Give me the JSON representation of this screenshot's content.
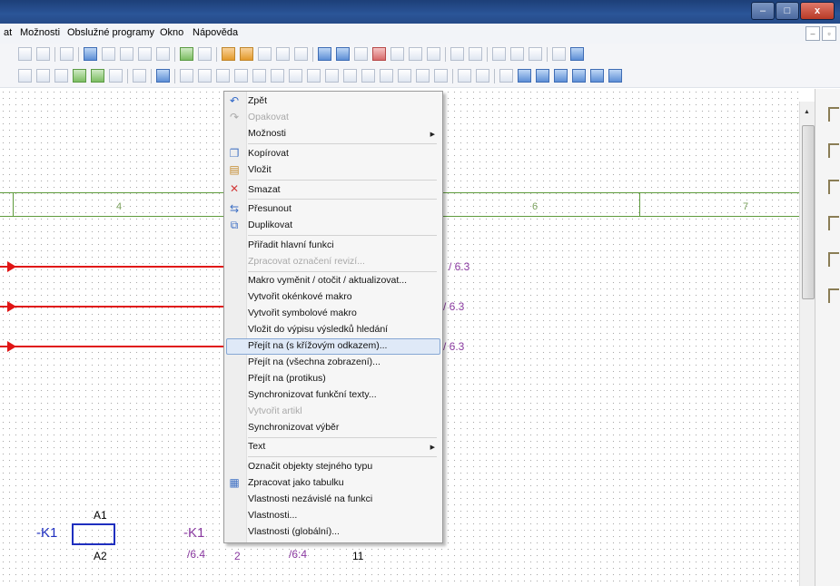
{
  "menubar": {
    "items": [
      "at",
      "Možnosti",
      "Obslužné programy",
      "Okno",
      "Nápověda"
    ]
  },
  "window_buttons": {
    "minimize": "–",
    "maximize": "□",
    "close": "x"
  },
  "canvas": {
    "zones": [
      "4",
      "6",
      "7"
    ],
    "xrefs": [
      "/ 6.3",
      "/ 6.3",
      "/ 6.3"
    ],
    "device": {
      "tag_left": "-K1",
      "coil_top": "A1",
      "coil_bottom": "A2",
      "tag_right": "-K1",
      "ref_right": "/6.4",
      "contact_a": "2",
      "contact_ref": "/6:4",
      "contact_b": "11"
    }
  },
  "context_menu": {
    "items": [
      {
        "label": "Zpět",
        "icon": "undo-icon",
        "enabled": true
      },
      {
        "label": "Opakovat",
        "icon": "redo-icon",
        "enabled": false
      },
      {
        "label": "Možnosti",
        "submenu": true,
        "enabled": true
      },
      {
        "label": "Kopírovat",
        "icon": "copy-icon",
        "enabled": true
      },
      {
        "label": "Vložit",
        "icon": "paste-icon",
        "enabled": true
      },
      {
        "label": "Smazat",
        "icon": "delete-icon",
        "enabled": true
      },
      {
        "label": "Přesunout",
        "icon": "move-icon",
        "enabled": true
      },
      {
        "label": "Duplikovat",
        "icon": "duplicate-icon",
        "enabled": true
      },
      {
        "label": "Přiřadit hlavní funkci",
        "enabled": true
      },
      {
        "label": "Zpracovat označení revizí...",
        "enabled": false
      },
      {
        "label": "Makro vyměnit / otočit / aktualizovat...",
        "enabled": true
      },
      {
        "label": "Vytvořit okénkové makro",
        "enabled": true
      },
      {
        "label": "Vytvořit symbolové makro",
        "enabled": true
      },
      {
        "label": "Vložit do výpisu výsledků hledání",
        "enabled": true
      },
      {
        "label": "Přejít na (s křížovým odkazem)...",
        "enabled": true,
        "highlighted": true
      },
      {
        "label": "Přejít na (všechna zobrazení)...",
        "enabled": true
      },
      {
        "label": "Přejít na (protikus)",
        "enabled": true
      },
      {
        "label": "Synchronizovat funkční texty...",
        "enabled": true
      },
      {
        "label": "Vytvořit artikl",
        "enabled": false
      },
      {
        "label": "Synchronizovat výběr",
        "enabled": true
      },
      {
        "label": "Text",
        "submenu": true,
        "enabled": true
      },
      {
        "label": "Označit objekty stejného typu",
        "enabled": true
      },
      {
        "label": "Zpracovat jako tabulku",
        "icon": "table-icon",
        "enabled": true
      },
      {
        "label": "Vlastnosti nezávislé na funkci",
        "enabled": true
      },
      {
        "label": "Vlastnosti...",
        "enabled": true
      },
      {
        "label": "Vlastnosti (globální)...",
        "enabled": true
      }
    ]
  },
  "colors": {
    "wire": "#e01515",
    "device": "#1f2fbf",
    "xref": "#8a3aa0",
    "grid_line": "#5e9b3c",
    "highlight": "#dfe9f7"
  }
}
